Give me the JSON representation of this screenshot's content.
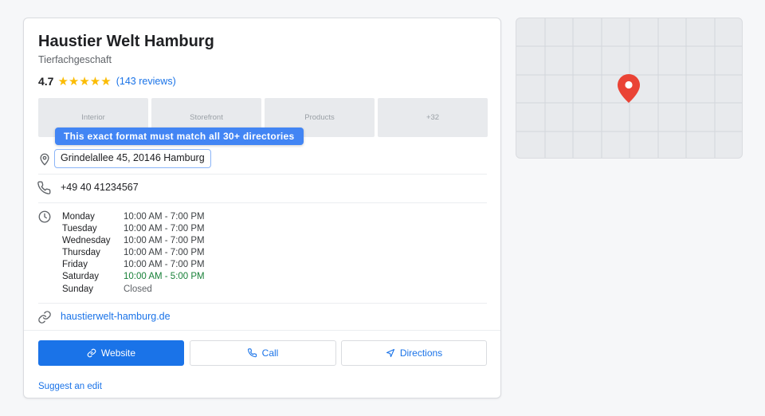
{
  "business": {
    "name": "Haustier Welt Hamburg",
    "category": "Tierfachgeschaft",
    "rating": "4.7",
    "stars": "★★★★★",
    "reviews": "(143 reviews)"
  },
  "photos": [
    {
      "label": "Interior"
    },
    {
      "label": "Storefront"
    },
    {
      "label": "Products"
    },
    {
      "label": "+32"
    }
  ],
  "tooltip": "This exact format must match all 30+ directories",
  "address": "Grindelallee 45, 20146 Hamburg",
  "phone": "+49 40 41234567",
  "hours": [
    {
      "day": "Monday",
      "time": "10:00 AM - 7:00 PM"
    },
    {
      "day": "Tuesday",
      "time": "10:00 AM - 7:00 PM"
    },
    {
      "day": "Wednesday",
      "time": "10:00 AM - 7:00 PM"
    },
    {
      "day": "Thursday",
      "time": "10:00 AM - 7:00 PM"
    },
    {
      "day": "Friday",
      "time": "10:00 AM - 7:00 PM"
    },
    {
      "day": "Saturday",
      "time": "10:00 AM - 5:00 PM"
    },
    {
      "day": "Sunday",
      "time": "Closed"
    }
  ],
  "website": "haustierwelt-hamburg.de",
  "actions": {
    "website": "Website",
    "call": "Call",
    "directions": "Directions"
  },
  "suggest_edit": "Suggest an edit",
  "colors": {
    "accent": "#1a73e8",
    "tooltip": "#4285f4",
    "star": "#fbbc04",
    "open_today": "#188038",
    "map_pin": "#ea4335"
  },
  "icons": {
    "address": "location-pin-icon",
    "phone": "phone-icon",
    "hours": "clock-icon",
    "website": "link-icon",
    "call_button": "phone-icon",
    "directions_button": "navigation-arrow-icon",
    "map": "map-pin-icon"
  }
}
